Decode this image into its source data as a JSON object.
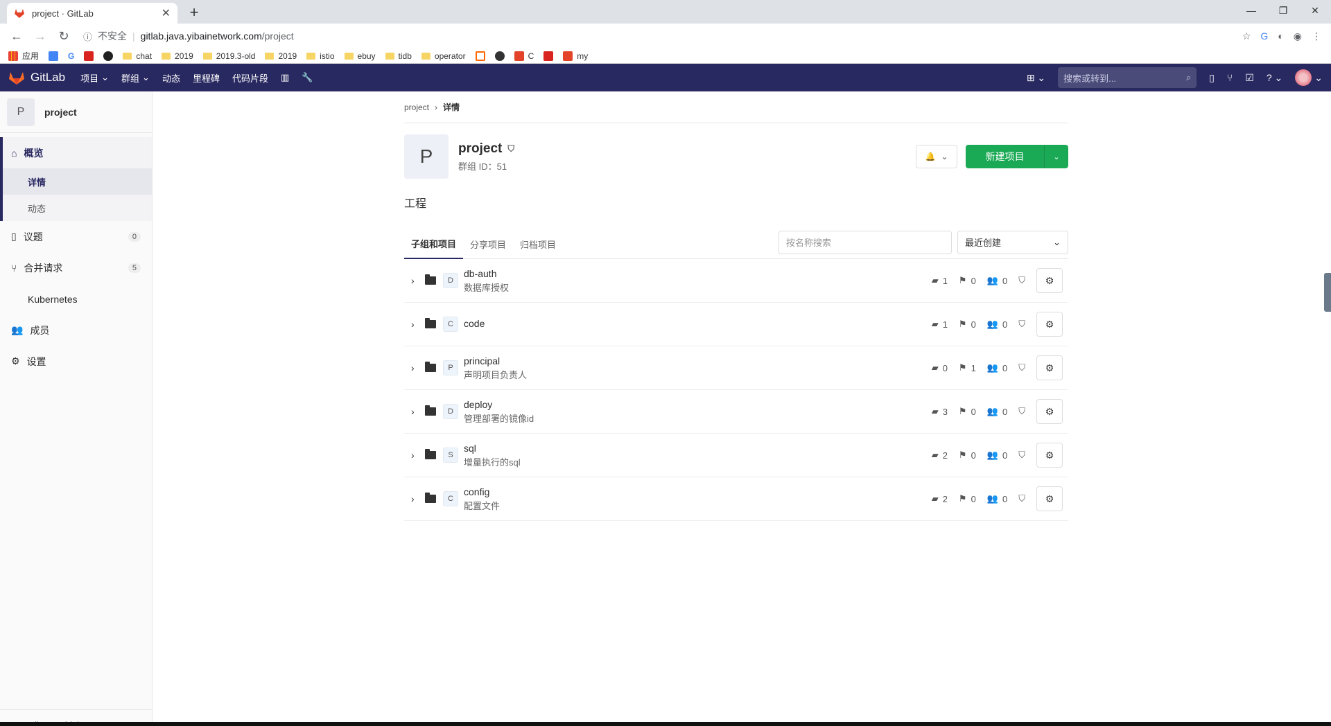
{
  "browser": {
    "tab_title": "project · GitLab",
    "url_insecure": "不安全",
    "url_host": "gitlab.java.yibainetwork.com",
    "url_path": "/project",
    "bookmarks": [
      "应用",
      "chat",
      "2019",
      "2019.3-old",
      "2019",
      "istio",
      "ebuy",
      "tidb",
      "operator",
      "C",
      "my"
    ]
  },
  "gitlab_header": {
    "brand": "GitLab",
    "nav": [
      "项目",
      "群组",
      "动态",
      "里程碑",
      "代码片段"
    ],
    "search_placeholder": "搜索或转到..."
  },
  "sidebar": {
    "group_avatar": "P",
    "group_name": "project",
    "overview": "概览",
    "sub_details": "详情",
    "sub_activity": "动态",
    "issues": "议题",
    "issues_count": "0",
    "merge_requests": "合并请求",
    "mr_count": "5",
    "kubernetes": "Kubernetes",
    "members": "成员",
    "settings": "设置",
    "collapse": "Collapse sidebar"
  },
  "breadcrumb": {
    "root": "project",
    "current": "详情"
  },
  "group": {
    "avatar": "P",
    "title": "project",
    "id_label": "群组 ID：51",
    "new_project": "新建项目",
    "description": "工程"
  },
  "tabs": [
    "子组和项目",
    "分享项目",
    "归档项目"
  ],
  "filter_placeholder": "按名称搜索",
  "sort_label": "最近创建",
  "items": [
    {
      "avatar": "D",
      "name": "db-auth",
      "desc": "数据库授权",
      "subgroups": "1",
      "projects": "0",
      "members": "0"
    },
    {
      "avatar": "C",
      "name": "code",
      "desc": "",
      "subgroups": "1",
      "projects": "0",
      "members": "0"
    },
    {
      "avatar": "P",
      "name": "principal",
      "desc": "声明项目负责人",
      "subgroups": "0",
      "projects": "1",
      "members": "0"
    },
    {
      "avatar": "D",
      "name": "deploy",
      "desc": "管理部署的镜像id",
      "subgroups": "3",
      "projects": "0",
      "members": "0"
    },
    {
      "avatar": "S",
      "name": "sql",
      "desc": "增量执行的sql",
      "subgroups": "2",
      "projects": "0",
      "members": "0"
    },
    {
      "avatar": "C",
      "name": "config",
      "desc": "配置文件",
      "subgroups": "2",
      "projects": "0",
      "members": "0"
    }
  ],
  "colors": {
    "header": "#292961",
    "new_button": "#1aaa55"
  }
}
